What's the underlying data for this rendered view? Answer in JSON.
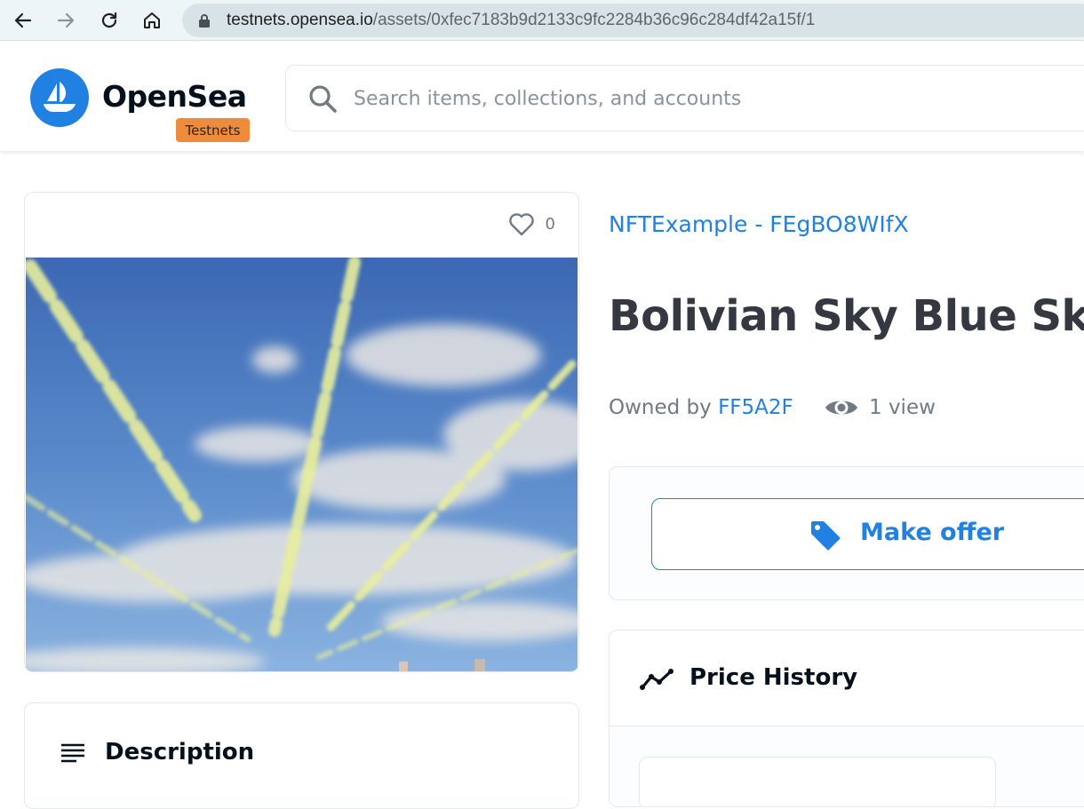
{
  "browser": {
    "url_domain": "testnets.opensea.io",
    "url_path": "/assets/0xfec7183b9d2133c9fc2284b36c96c284df42a15f/1"
  },
  "header": {
    "brand": "OpenSea",
    "badge": "Testnets",
    "search_placeholder": "Search items, collections, and accounts"
  },
  "asset": {
    "favorites_count": "0",
    "collection": "NFTExample - FEgBO8WIfX",
    "title": "Bolivian Sky Blue Sky",
    "owned_by_label": "Owned by",
    "owner": "FF5A2F",
    "views": "1 view"
  },
  "actions": {
    "make_offer": "Make offer"
  },
  "sections": {
    "description": "Description",
    "price_history": "Price History"
  },
  "colors": {
    "accent": "#2081e2",
    "badge": "#ef8c3b",
    "text_primary": "#353840",
    "text_secondary": "#707a83"
  }
}
